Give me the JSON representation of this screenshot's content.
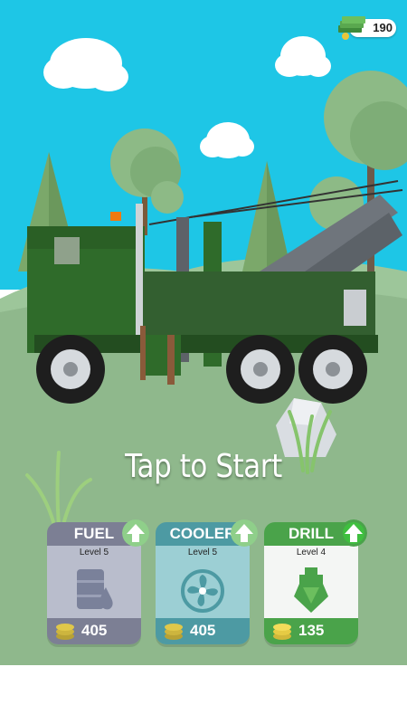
{
  "hud": {
    "money": "190",
    "money_icon": "cash-stack-icon",
    "coin_icon": "coin-stack-icon"
  },
  "prompt": {
    "text": "Tap to Start"
  },
  "upgrades": [
    {
      "title": "FUEL",
      "level": "Level 5",
      "price": "405",
      "icon": "fuel-barrel-icon",
      "upgrade_icon": "up-arrow-icon",
      "affordable": false
    },
    {
      "title": "COOLER",
      "level": "Level 5",
      "price": "405",
      "icon": "fan-icon",
      "upgrade_icon": "up-arrow-icon",
      "affordable": false
    },
    {
      "title": "DRILL",
      "level": "Level 4",
      "price": "135",
      "icon": "drill-head-icon",
      "upgrade_icon": "up-arrow-icon",
      "affordable": true
    }
  ],
  "colors": {
    "sky": "#1ec6e6",
    "ground": "#8fb88c",
    "truck": "#2f6b2a",
    "upgrade_enabled": "#4aa34a",
    "upgrade_disabled": "#8fcf8a"
  }
}
